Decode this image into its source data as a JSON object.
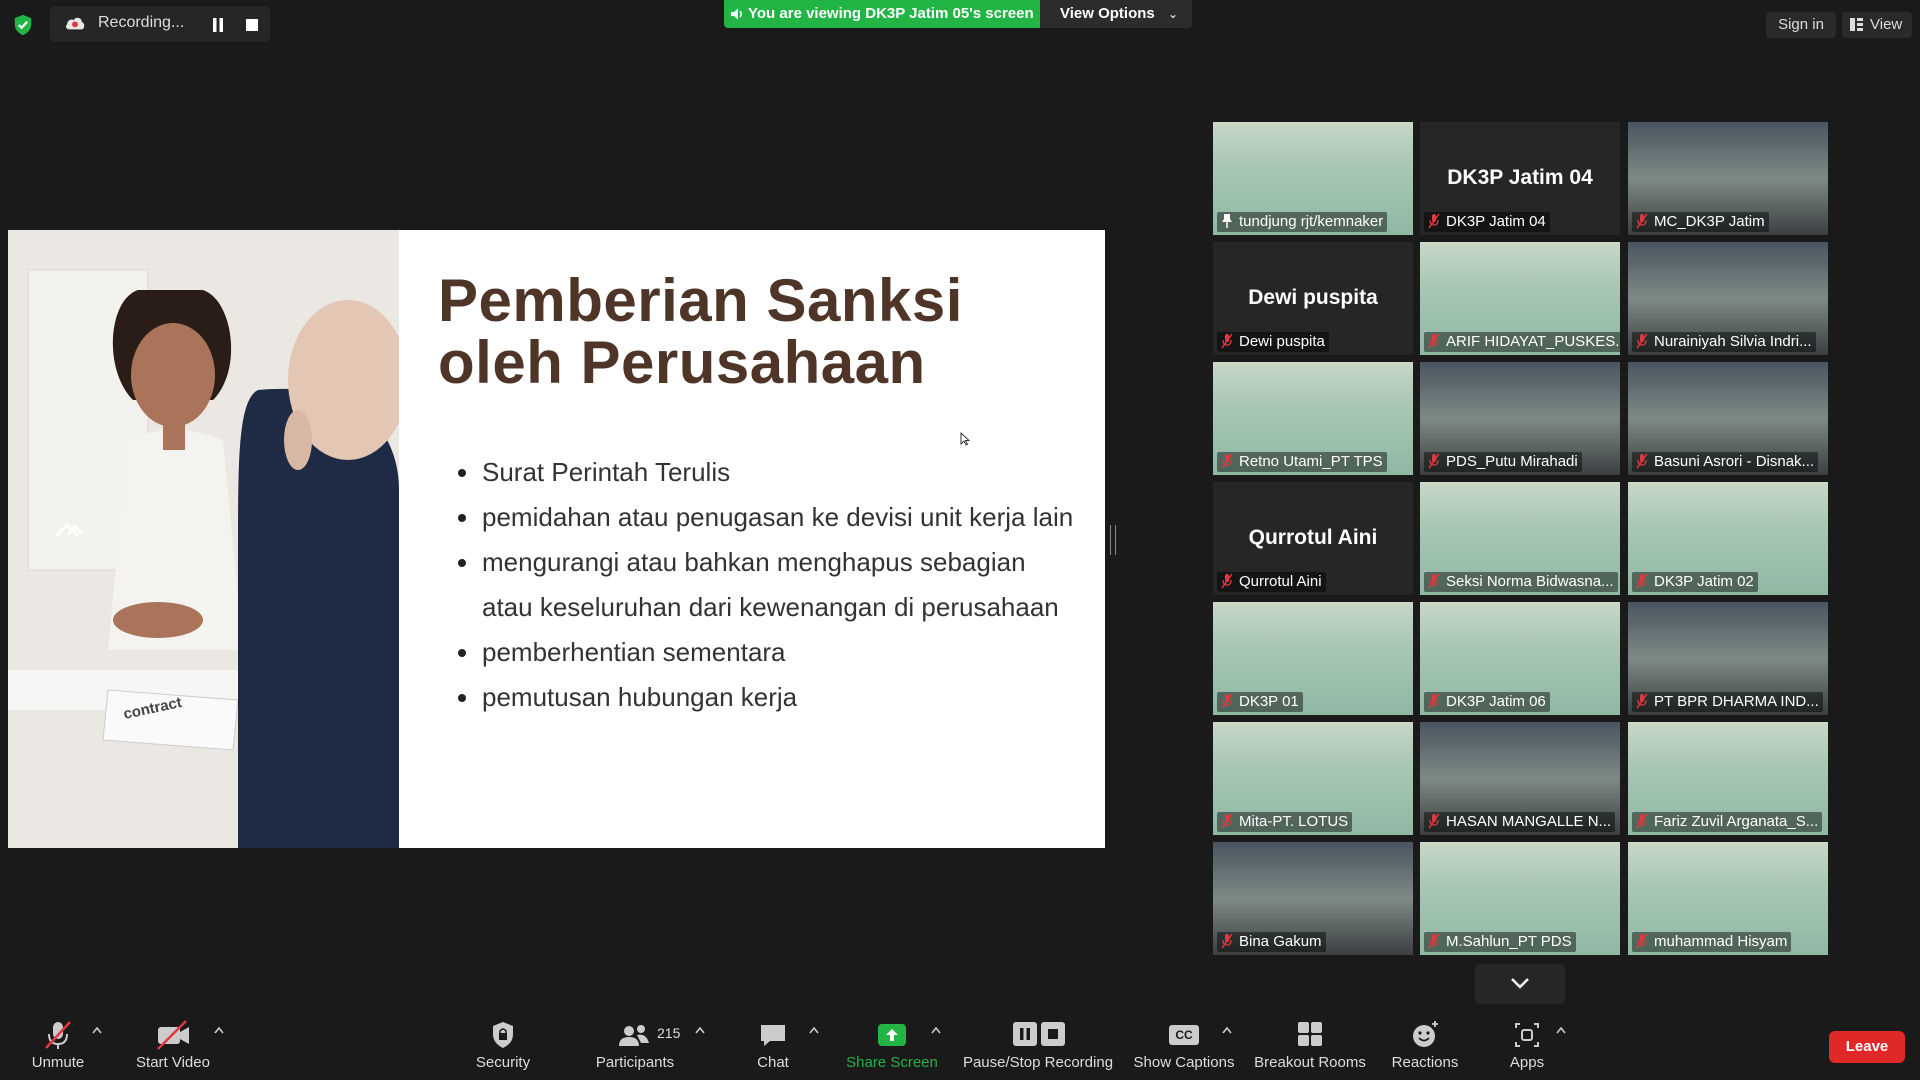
{
  "recording": {
    "label": "Recording..."
  },
  "share_banner": {
    "text": "You are viewing DK3P Jatim 05's screen",
    "view_options": "View Options"
  },
  "top_right": {
    "sign_in": "Sign in",
    "view": "View"
  },
  "slide": {
    "title_line1": "Pemberian Sanksi",
    "title_line2": "oleh Perusahaan",
    "bullets": [
      "Surat Perintah Terulis",
      "pemidahan atau penugasan ke devisi unit kerja lain",
      "mengurangi atau bahkan menghapus sebagian atau keseluruhan dari kewenangan di perusahaan",
      "pemberhentian sementara",
      "pemutusan hubungan kerja"
    ],
    "photo_text": "contract"
  },
  "gallery": {
    "tiles": [
      {
        "label": "tundjung rjt/kemnaker",
        "big": ""
      },
      {
        "label": "DK3P Jatim 04",
        "big": "DK3P Jatim 04"
      },
      {
        "label": "MC_DK3P Jatim",
        "big": ""
      },
      {
        "label": "Dewi puspita",
        "big": "Dewi puspita"
      },
      {
        "label": "ARIF HIDAYAT_PUSKES...",
        "big": ""
      },
      {
        "label": "Nurainiyah Silvia Indri...",
        "big": ""
      },
      {
        "label": "Retno Utami_PT TPS",
        "big": ""
      },
      {
        "label": "PDS_Putu Mirahadi",
        "big": ""
      },
      {
        "label": "Basuni Asrori - Disnak...",
        "big": ""
      },
      {
        "label": "Qurrotul Aini",
        "big": "Qurrotul Aini"
      },
      {
        "label": "Seksi Norma Bidwasna...",
        "big": ""
      },
      {
        "label": "DK3P Jatim 02",
        "big": ""
      },
      {
        "label": "DK3P 01",
        "big": ""
      },
      {
        "label": "DK3P Jatim 06",
        "big": ""
      },
      {
        "label": "PT BPR DHARMA IND...",
        "big": ""
      },
      {
        "label": "Mita-PT. LOTUS",
        "big": ""
      },
      {
        "label": "HASAN MANGALLE N...",
        "big": ""
      },
      {
        "label": "Fariz Zuvil Arganata_S...",
        "big": ""
      },
      {
        "label": "Bina Gakum",
        "big": ""
      },
      {
        "label": "M.Sahlun_PT PDS",
        "big": ""
      },
      {
        "label": "muhammad Hisyam",
        "big": ""
      }
    ]
  },
  "toolbar": {
    "unmute": "Unmute",
    "start_video": "Start Video",
    "security": "Security",
    "participants": "Participants",
    "participant_count": "215",
    "chat": "Chat",
    "share_screen": "Share Screen",
    "pause_stop": "Pause/Stop Recording",
    "captions": "Show Captions",
    "captions_glyph": "CC",
    "breakout": "Breakout Rooms",
    "reactions": "Reactions",
    "apps": "Apps",
    "leave": "Leave"
  },
  "colors": {
    "share_green": "#23b446",
    "leave_red": "#e02828",
    "active_speaker": "#e6e44d",
    "mute_red": "#e0383e"
  }
}
